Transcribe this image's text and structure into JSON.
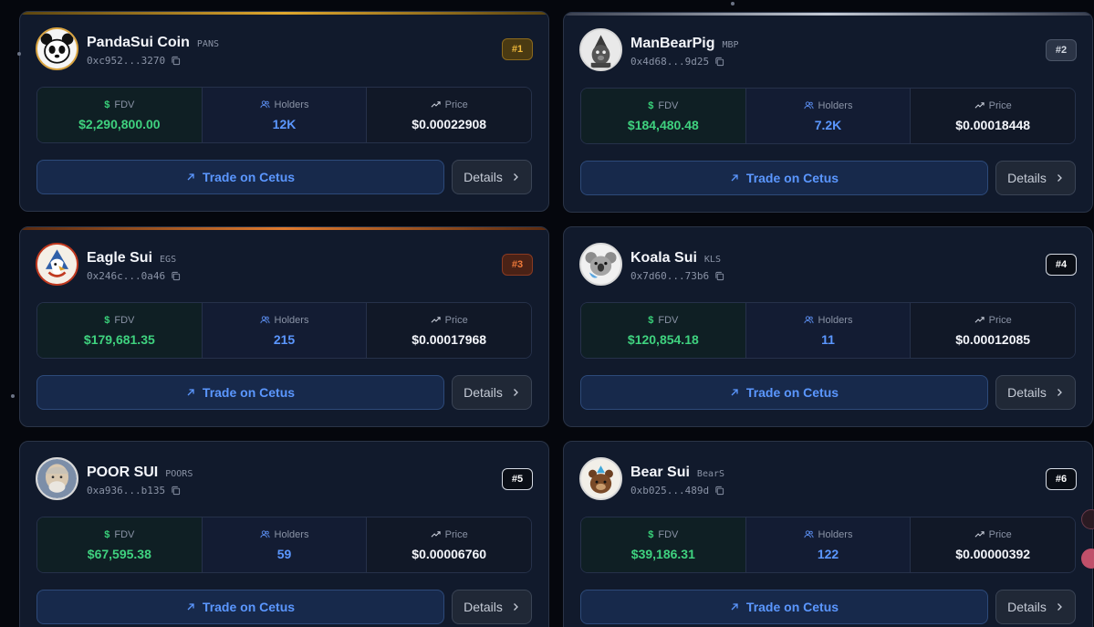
{
  "trade_label": "Trade on Cetus",
  "details_label": "Details",
  "labels": {
    "fdv": "FDV",
    "holders": "Holders",
    "price": "Price"
  },
  "tokens": [
    {
      "name": "PandaSui Coin",
      "ticker": "PANS",
      "address": "0xc952...3270",
      "rank": "#1",
      "fdv": "$2,290,800.00",
      "holders": "12K",
      "price": "$0.00022908",
      "avatar": "panda-avatar"
    },
    {
      "name": "ManBearPig",
      "ticker": "MBP",
      "address": "0x4d68...9d25",
      "rank": "#2",
      "fdv": "$184,480.48",
      "holders": "7.2K",
      "price": "$0.00018448",
      "avatar": "manbearpig-avatar"
    },
    {
      "name": "Eagle Sui",
      "ticker": "EGS",
      "address": "0x246c...0a46",
      "rank": "#3",
      "fdv": "$179,681.35",
      "holders": "215",
      "price": "$0.00017968",
      "avatar": "eagle-avatar"
    },
    {
      "name": "Koala Sui",
      "ticker": "KLS",
      "address": "0x7d60...73b6",
      "rank": "#4",
      "fdv": "$120,854.18",
      "holders": "11",
      "price": "$0.00012085",
      "avatar": "koala-avatar"
    },
    {
      "name": "POOR SUI",
      "ticker": "POORS",
      "address": "0xa936...b135",
      "rank": "#5",
      "fdv": "$67,595.38",
      "holders": "59",
      "price": "$0.00006760",
      "avatar": "poor-sui-avatar"
    },
    {
      "name": "Bear Sui",
      "ticker": "BearS",
      "address": "0xb025...489d",
      "rank": "#6",
      "fdv": "$39,186.31",
      "holders": "122",
      "price": "$0.00000392",
      "avatar": "bear-avatar"
    }
  ],
  "colors": {
    "fdv": "#3fd27f",
    "holders": "#5b97ff",
    "rank_gold": "#f0b93b",
    "rank_bronze": "#f07a3b",
    "accent_blue": "#5b97ff"
  }
}
